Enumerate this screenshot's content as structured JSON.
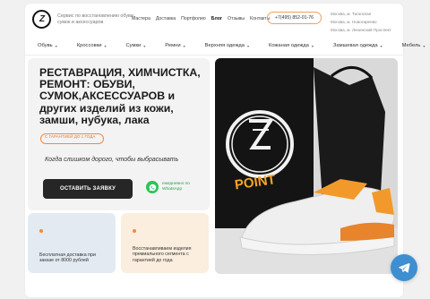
{
  "header": {
    "logo_text": "Z",
    "tagline": "Сервис по восстановлению обуви, сумок и аксессуаров",
    "nav": [
      "Мастера",
      "Доставка",
      "Портфолио",
      "Блог",
      "Отзывы",
      "Контакты"
    ],
    "nav_active": "Блог",
    "phone": "+7(495) 852-01-76",
    "addresses": [
      "Москва, м. Таганская",
      "Москва, м. Новогиреево",
      "Москва, м. Ленинский Проспект"
    ]
  },
  "categories": [
    "Обувь",
    "Кроссовки",
    "Сумки",
    "Ремни",
    "Верхняя одежда",
    "Кожаная одежда",
    "Замшевая одежда",
    "Мебель"
  ],
  "hero": {
    "title": "РЕСТАВРАЦИЯ, ХИМЧИСТКА, РЕМОНТ: ОБУВИ, СУМОК,АКСЕССУАРОВ и других изделий из кожи, замши, нубука, лака",
    "badge": "С ГАРАНТИЕЙ ДО 1 ГОДА",
    "subline": "Когда слишком дорого, чтобы выбрасывать",
    "cta": "ОСТАВИТЬ ЗАЯВКУ",
    "whatsapp_line1": "ежедневно по",
    "whatsapp_line2": "WhatsApp"
  },
  "cards": [
    {
      "text": "Бесплатная доставка при заказе от 8000 рублей"
    },
    {
      "text": "Восстанавливаем изделия премиального сегмента с гарантией до года"
    }
  ],
  "photo": {
    "neon_text": "POINT"
  },
  "colors": {
    "accent": "#f08a40",
    "dark": "#262626",
    "whatsapp": "#2dc35a",
    "telegram": "#3d8fd1"
  }
}
